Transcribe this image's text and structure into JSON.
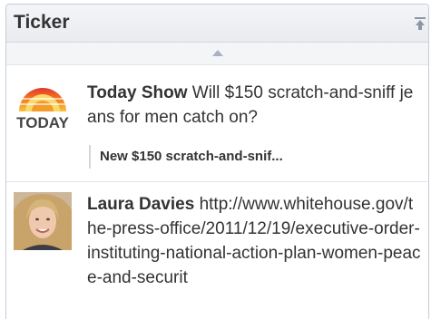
{
  "header": {
    "title": "Ticker",
    "popout_icon": "popout-arrow-icon"
  },
  "scroll": {
    "up_icon": "scroll-up-icon"
  },
  "stories": [
    {
      "author": "Today Show",
      "text": "Will $150 scratch-and-sniff jeans for men catch on?",
      "link_preview": "New $150 scratch-and-snif...",
      "avatar_icon": "today-show-logo",
      "logo_text": "TODAY"
    },
    {
      "author": "Laura Davies",
      "text": "http://www.whitehouse.gov/the-press-office/2011/12/19/executive-order-instituting-national-action-plan-women-peace-and-securit",
      "avatar_icon": "profile-photo"
    }
  ],
  "colors": {
    "header_bg": "#eceef2",
    "border": "#c4cbd7",
    "text": "#333333",
    "scroll_arrow": "#a6b1c2",
    "logo_orange": "#f5a623",
    "logo_red": "#e2372b"
  }
}
